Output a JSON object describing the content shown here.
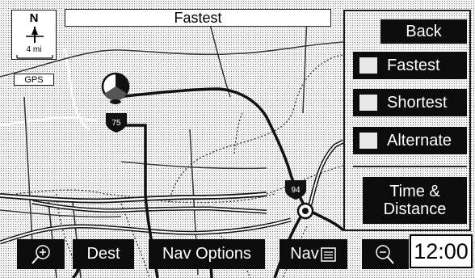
{
  "map": {
    "title": "Fastest",
    "compass": "N",
    "scale": "4 mi",
    "gps": "GPS",
    "highway_shields": [
      "75",
      "94"
    ]
  },
  "menu": {
    "back_label": "Back",
    "route_options": [
      {
        "label": "Fastest",
        "checked": false
      },
      {
        "label": "Shortest",
        "checked": false
      },
      {
        "label": "Alternate",
        "checked": false
      }
    ],
    "time_distance_line1": "Time &",
    "time_distance_line2": "Distance"
  },
  "toolbar": {
    "zoom_in_icon": "zoom-in-icon",
    "dest_label": "Dest",
    "nav_options_label": "Nav Options",
    "nav_label": "Nav",
    "nav_icon": "list-icon",
    "zoom_out_icon": "zoom-out-icon"
  },
  "clock": "12:00",
  "colors": {
    "button": "#0c0c0c",
    "map_background": "#f3f3f3",
    "route": "#111111"
  }
}
